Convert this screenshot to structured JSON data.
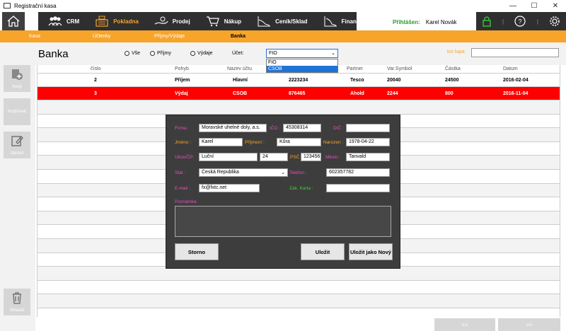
{
  "window": {
    "title": "Registrační kasa",
    "minimize": "—",
    "maximize": "☐",
    "close": "✕"
  },
  "nav": {
    "items": [
      {
        "label": "CRM",
        "icon": "group-icon"
      },
      {
        "label": "Pokladna",
        "icon": "cash-register-icon",
        "active": true
      },
      {
        "label": "Prodej",
        "icon": "hand-coin-icon"
      },
      {
        "label": "Nákup",
        "icon": "cart-icon"
      },
      {
        "label": "Ceník/Sklad",
        "icon": "chart-line-icon"
      },
      {
        "label": "Finance",
        "icon": "finance-icon"
      }
    ],
    "logged_label": "Přihlášen:",
    "user": "Karel Novák"
  },
  "subnav": {
    "kasa": "Kasa",
    "uctenky": "Účtenky",
    "prijmy_vydaje": "Příjmy/Výdaje",
    "banka": "Banka"
  },
  "page": {
    "title": "Banka",
    "filters": {
      "vse": "Vše",
      "prijmy": "Příjmy",
      "vydaje": "Výdaje"
    },
    "ucet_label": "Účet:",
    "ucet_value": "FIO",
    "ucet_options": [
      "FIO",
      "CSOB"
    ],
    "lupa_label": "ico lupa:"
  },
  "sidebar": {
    "new": "Nový",
    "copy": "Kopírovat",
    "edit": "Upravit",
    "delete": "Smazat"
  },
  "table": {
    "headers": [
      "číslo",
      "Pohyb",
      "Nazev účtu",
      "",
      "Partner",
      "Var.Symbol",
      "Částka",
      "Datum"
    ],
    "rows": [
      {
        "cislo": "2",
        "pohyb": "Příjem",
        "ucet": "Hlavní",
        "cislo_uctu": "2223234",
        "partner": "Tesco",
        "vs": "20040",
        "castka": "24500",
        "datum": "2016-02-04",
        "selected": false
      },
      {
        "cislo": "3",
        "pohyb": "Výdaj",
        "ucet": "CSOB",
        "cislo_uctu": "876465",
        "partner": "Ahold",
        "vs": "2244",
        "castka": "800",
        "datum": "2016-11-04",
        "selected": true
      }
    ]
  },
  "pager": {
    "prev": "<<",
    "next": ">>"
  },
  "dialog": {
    "firma_label": "Firma :",
    "firma": "Moravské uhelné doly, a.s.",
    "ico_label": "IČO :",
    "ico": "45308314",
    "dic_label": "DIČ :",
    "dic": "",
    "jmeno_label": "Jméno :",
    "jmeno": "Karel",
    "prijmeni_label": "Příjmení :",
    "prijmeni": "Kůra",
    "narozen_label": "Narozen :",
    "narozen": "1978-04-22",
    "ulice_label": "Ulice/ČP:",
    "ulice": "Luční",
    "cp": "24",
    "psc_label": "PSČ",
    "psc": "123456",
    "mesto_label": "Město :",
    "mesto": "Tanvald",
    "stat_label": "Stát :",
    "stat": "Česká Republika",
    "telefon_label": "Telefon :",
    "telefon": "602357782",
    "email_label": "E-mail :",
    "email": "fx@fxtc.net",
    "karta_label": "Zák. Karta :",
    "karta": "",
    "poznamka_label": "Poznámka",
    "storno": "Storno",
    "ulozit": "Uložit",
    "ulozit_novy": "Uložit jako Nový"
  }
}
